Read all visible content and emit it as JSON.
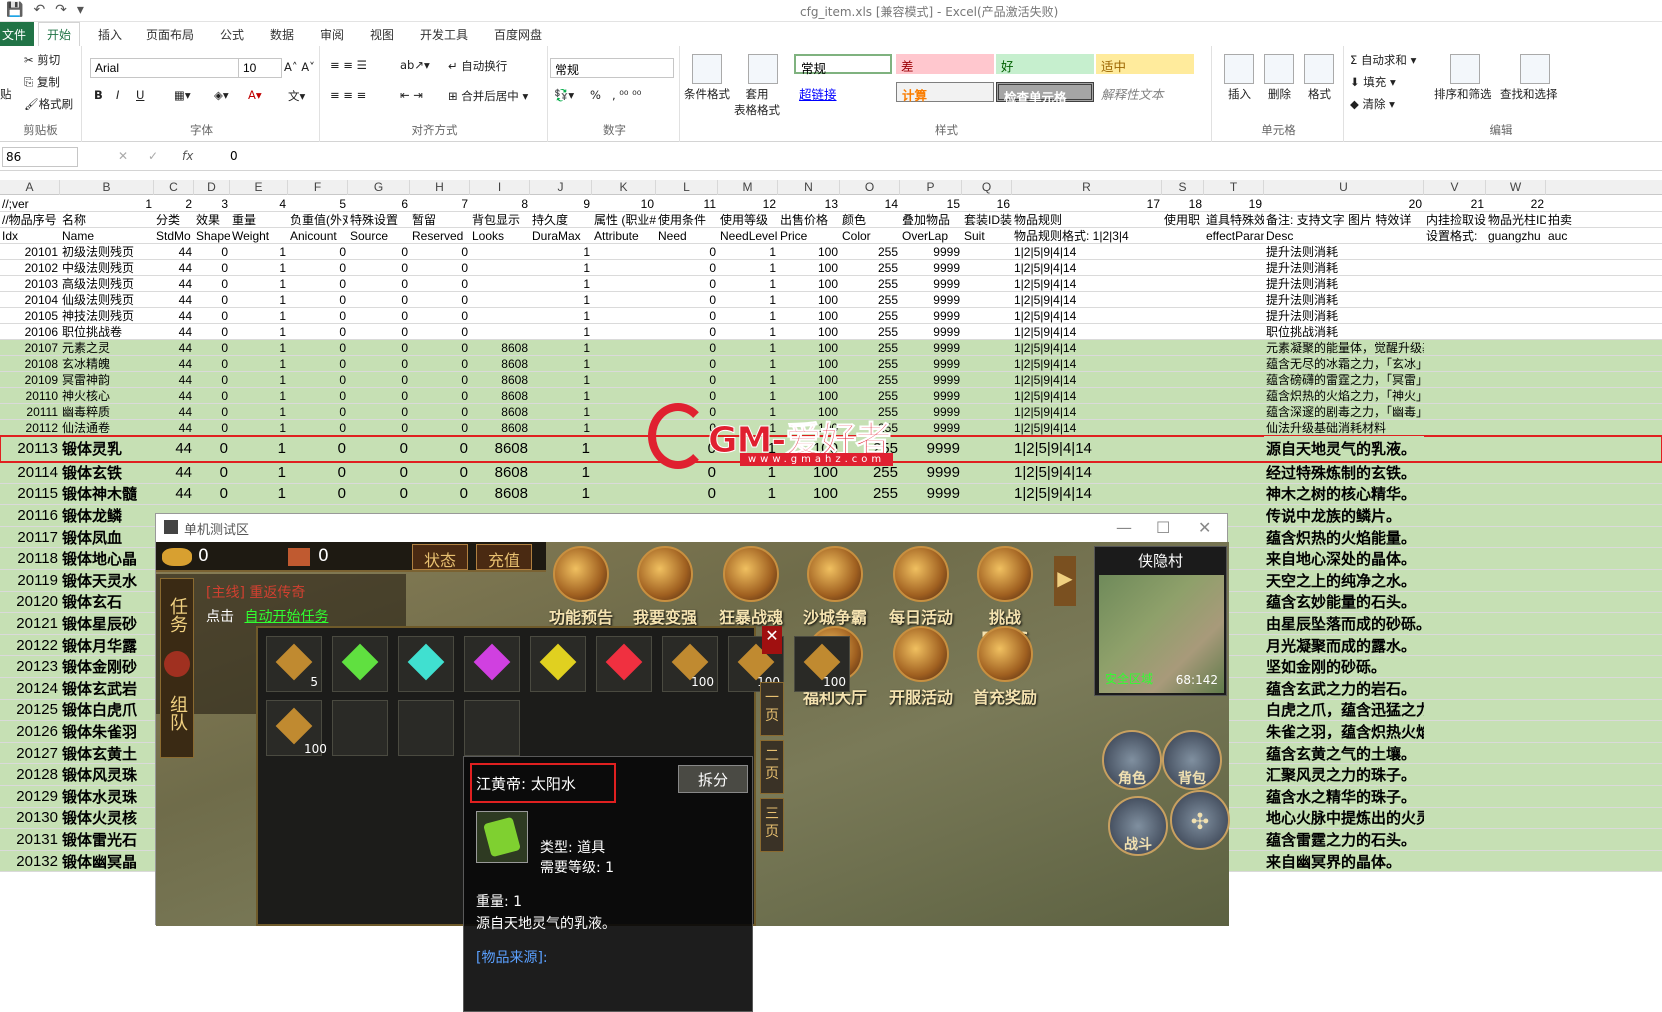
{
  "titlebar": {
    "title": "cfg_item.xls  [兼容模式] - Excel(产品激活失败)"
  },
  "tabs": [
    "文件",
    "开始",
    "插入",
    "页面布局",
    "公式",
    "数据",
    "审阅",
    "视图",
    "开发工具",
    "百度网盘"
  ],
  "ribbon": {
    "clipboard": {
      "cut": "剪切",
      "copy": "复制",
      "format_painter": "格式刷",
      "paste": "贴",
      "label": "剪贴板"
    },
    "font": {
      "name": "Arial",
      "size": "10",
      "label": "字体",
      "bold": "B",
      "italic": "I",
      "underline": "U"
    },
    "align": {
      "wrap": "自动换行",
      "merge": "合并后居中",
      "label": "对齐方式"
    },
    "number": {
      "format": "常规",
      "pct": "%",
      "label": "数字"
    },
    "styles": {
      "cond": "条件格式",
      "table": "套用\n表格格式",
      "normal": "常规",
      "bad": "差",
      "good": "好",
      "neutral": "适中",
      "hyperlink": "超链接",
      "calc": "计算",
      "check": "检查单元格",
      "explain": "解释性文本",
      "label": "样式"
    },
    "cells": {
      "insert": "插入",
      "delete": "删除",
      "format": "格式",
      "label": "单元格"
    },
    "editing": {
      "autosum": "自动求和",
      "fill": "填充",
      "clear": "清除",
      "sort": "排序和筛选",
      "find": "查找和选择",
      "label": "编辑"
    }
  },
  "formula_bar": {
    "name_box": "86",
    "fx": "fx",
    "value": "0"
  },
  "columns": [
    "A",
    "B",
    "C",
    "D",
    "E",
    "F",
    "G",
    "H",
    "I",
    "J",
    "K",
    "L",
    "M",
    "N",
    "O",
    "P",
    "Q",
    "R",
    "S",
    "T",
    "U",
    "V",
    "W"
  ],
  "header_rows": [
    [
      "//;ver",
      "1",
      "2",
      "3",
      "4",
      "5",
      "6",
      "7",
      "8",
      "9",
      "10",
      "11",
      "12",
      "13",
      "14",
      "15",
      "16",
      "17",
      "18",
      "19",
      "20",
      "21",
      "22"
    ],
    [
      "//物品序号",
      "名称",
      "分类",
      "效果",
      "重量",
      "负重值(外对",
      "特殊设置",
      "暂留",
      "背包显示",
      "持久度",
      "属性 (职业#",
      "使用条件",
      "使用等级",
      "出售价格",
      "颜色",
      "叠加物品",
      "套装ID装",
      "物品规则",
      "使用职",
      "道具特殊效",
      "备注: 支持文字 图片 特效详",
      "内挂捡取设",
      "物品光柱ID",
      "拍卖"
    ],
    [
      "Idx",
      "Name",
      "StdMo",
      "Shape",
      "Weight",
      "Anicount",
      "Source",
      "Reserved",
      "Looks",
      "DuraMax",
      "Attribute",
      "Need",
      "NeedLevel",
      "Price",
      "Color",
      "OverLap",
      "Suit",
      "物品规则格式: 1|2|3|4",
      "",
      "effectParam",
      "Desc",
      "设置格式:",
      "guangzhu",
      "auc"
    ]
  ],
  "rows": [
    {
      "idx": "20101",
      "name": "初级法则残页",
      "stdmode": "44",
      "shape": "0",
      "weight": "1",
      "anicount": "0",
      "source": "0",
      "reserved": "0",
      "looks": "",
      "dura": "1",
      "need": "0",
      "needlevel": "1",
      "price": "100",
      "color": "255",
      "overlap": "9999",
      "rule": "1|2|5|9|4|14",
      "desc": "提升法则消耗",
      "style": "normal"
    },
    {
      "idx": "20102",
      "name": "中级法则残页",
      "stdmode": "44",
      "shape": "0",
      "weight": "1",
      "anicount": "0",
      "source": "0",
      "reserved": "0",
      "looks": "",
      "dura": "1",
      "need": "0",
      "needlevel": "1",
      "price": "100",
      "color": "255",
      "overlap": "9999",
      "rule": "1|2|5|9|4|14",
      "desc": "提升法则消耗",
      "style": "normal"
    },
    {
      "idx": "20103",
      "name": "高级法则残页",
      "stdmode": "44",
      "shape": "0",
      "weight": "1",
      "anicount": "0",
      "source": "0",
      "reserved": "0",
      "looks": "",
      "dura": "1",
      "need": "0",
      "needlevel": "1",
      "price": "100",
      "color": "255",
      "overlap": "9999",
      "rule": "1|2|5|9|4|14",
      "desc": "提升法则消耗",
      "style": "normal"
    },
    {
      "idx": "20104",
      "name": "仙级法则残页",
      "stdmode": "44",
      "shape": "0",
      "weight": "1",
      "anicount": "0",
      "source": "0",
      "reserved": "0",
      "looks": "",
      "dura": "1",
      "need": "0",
      "needlevel": "1",
      "price": "100",
      "color": "255",
      "overlap": "9999",
      "rule": "1|2|5|9|4|14",
      "desc": "提升法则消耗",
      "style": "normal"
    },
    {
      "idx": "20105",
      "name": "神技法则残页",
      "stdmode": "44",
      "shape": "0",
      "weight": "1",
      "anicount": "0",
      "source": "0",
      "reserved": "0",
      "looks": "",
      "dura": "1",
      "need": "0",
      "needlevel": "1",
      "price": "100",
      "color": "255",
      "overlap": "9999",
      "rule": "1|2|5|9|4|14",
      "desc": "提升法则消耗",
      "style": "normal"
    },
    {
      "idx": "20106",
      "name": "职位挑战卷",
      "stdmode": "44",
      "shape": "0",
      "weight": "1",
      "anicount": "0",
      "source": "0",
      "reserved": "0",
      "looks": "",
      "dura": "1",
      "need": "0",
      "needlevel": "1",
      "price": "100",
      "color": "255",
      "overlap": "9999",
      "rule": "1|2|5|9|4|14",
      "desc": "职位挑战消耗",
      "style": "normal"
    },
    {
      "idx": "20107",
      "name": "元素之灵",
      "stdmode": "44",
      "shape": "0",
      "weight": "1",
      "anicount": "0",
      "source": "0",
      "reserved": "0",
      "looks": "8608",
      "dura": "1",
      "need": "0",
      "needlevel": "1",
      "price": "100",
      "color": "255",
      "overlap": "9999",
      "rule": "1|2|5|9|4|14",
      "desc": "元素凝聚的能量体，觉醒升级基础消耗材料",
      "style": "green"
    },
    {
      "idx": "20108",
      "name": "玄冰精魄",
      "stdmode": "44",
      "shape": "0",
      "weight": "1",
      "anicount": "0",
      "source": "0",
      "reserved": "0",
      "looks": "8608",
      "dura": "1",
      "need": "0",
      "needlevel": "1",
      "price": "100",
      "color": "255",
      "overlap": "9999",
      "rule": "1|2|5|9|4|14",
      "desc": "蕴含无尽的冰霜之力，「玄冰」升级消耗材料",
      "style": "green"
    },
    {
      "idx": "20109",
      "name": "冥雷神韵",
      "stdmode": "44",
      "shape": "0",
      "weight": "1",
      "anicount": "0",
      "source": "0",
      "reserved": "0",
      "looks": "8608",
      "dura": "1",
      "need": "0",
      "needlevel": "1",
      "price": "100",
      "color": "255",
      "overlap": "9999",
      "rule": "1|2|5|9|4|14",
      "desc": "蕴含磅礴的雷霆之力，「冥雷」升级消耗材料",
      "style": "green"
    },
    {
      "idx": "20110",
      "name": "神火核心",
      "stdmode": "44",
      "shape": "0",
      "weight": "1",
      "anicount": "0",
      "source": "0",
      "reserved": "0",
      "looks": "8608",
      "dura": "1",
      "need": "0",
      "needlevel": "1",
      "price": "100",
      "color": "255",
      "overlap": "9999",
      "rule": "1|2|5|9|4|14",
      "desc": "蕴含炽热的火焰之力，「神火」升级消耗材料",
      "style": "green"
    },
    {
      "idx": "20111",
      "name": "幽毒粹质",
      "stdmode": "44",
      "shape": "0",
      "weight": "1",
      "anicount": "0",
      "source": "0",
      "reserved": "0",
      "looks": "8608",
      "dura": "1",
      "need": "0",
      "needlevel": "1",
      "price": "100",
      "color": "255",
      "overlap": "9999",
      "rule": "1|2|5|9|4|14",
      "desc": "蕴含深邃的剧毒之力，「幽毒」升级消耗材料",
      "style": "green"
    },
    {
      "idx": "20112",
      "name": "仙法通卷",
      "stdmode": "44",
      "shape": "0",
      "weight": "1",
      "anicount": "0",
      "source": "0",
      "reserved": "0",
      "looks": "8608",
      "dura": "1",
      "need": "0",
      "needlevel": "1",
      "price": "100",
      "color": "255",
      "overlap": "9999",
      "rule": "1|2|5|9|4|14",
      "desc": "仙法升级基础消耗材料",
      "style": "green"
    },
    {
      "idx": "20113",
      "name": "锻体灵乳",
      "stdmode": "44",
      "shape": "0",
      "weight": "1",
      "anicount": "0",
      "source": "0",
      "reserved": "0",
      "looks": "8608",
      "dura": "1",
      "need": "0",
      "needlevel": "1",
      "price": "100",
      "color": "255",
      "overlap": "9999",
      "rule": "1|2|5|9|4|14",
      "desc": "源自天地灵气的乳液。",
      "style": "big sel green"
    },
    {
      "idx": "20114",
      "name": "锻体玄铁",
      "stdmode": "44",
      "shape": "0",
      "weight": "1",
      "anicount": "0",
      "source": "0",
      "reserved": "0",
      "looks": "8608",
      "dura": "1",
      "need": "0",
      "needlevel": "1",
      "price": "100",
      "color": "255",
      "overlap": "9999",
      "rule": "1|2|5|9|4|14",
      "desc": "经过特殊炼制的玄铁。",
      "style": "big green"
    },
    {
      "idx": "20115",
      "name": "锻体神木髓",
      "stdmode": "44",
      "shape": "0",
      "weight": "1",
      "anicount": "0",
      "source": "0",
      "reserved": "0",
      "looks": "8608",
      "dura": "1",
      "need": "0",
      "needlevel": "1",
      "price": "100",
      "color": "255",
      "overlap": "9999",
      "rule": "1|2|5|9|4|14",
      "desc": "神木之树的核心精华。",
      "style": "big green"
    },
    {
      "idx": "20116",
      "name": "锻体龙鳞",
      "desc": "传说中龙族的鳞片。",
      "style": "big green"
    },
    {
      "idx": "20117",
      "name": "锻体凤血",
      "desc": "蕴含炽热的火焰能量。",
      "style": "big green"
    },
    {
      "idx": "20118",
      "name": "锻体地心晶",
      "desc": "来自地心深处的晶体。",
      "style": "big green"
    },
    {
      "idx": "20119",
      "name": "锻体天灵水",
      "desc": "天空之上的纯净之水。",
      "style": "big green"
    },
    {
      "idx": "20120",
      "name": "锻体玄石",
      "desc": "蕴含玄妙能量的石头。",
      "style": "big green"
    },
    {
      "idx": "20121",
      "name": "锻体星辰砂",
      "desc": "由星辰坠落而成的砂砾。",
      "style": "big green"
    },
    {
      "idx": "20122",
      "name": "锻体月华露",
      "desc": "月光凝聚而成的露水。",
      "style": "big green"
    },
    {
      "idx": "20123",
      "name": "锻体金刚砂",
      "desc": "坚如金刚的砂砾。",
      "style": "big green"
    },
    {
      "idx": "20124",
      "name": "锻体玄武岩",
      "desc": "蕴含玄武之力的岩石。",
      "style": "big green"
    },
    {
      "idx": "20125",
      "name": "锻体白虎爪",
      "desc": "白虎之爪，蕴含迅猛之力。",
      "style": "big green"
    },
    {
      "idx": "20126",
      "name": "锻体朱雀羽",
      "desc": "朱雀之羽，蕴含炽热火焰。",
      "style": "big green"
    },
    {
      "idx": "20127",
      "name": "锻体玄黄土",
      "desc": "蕴含玄黄之气的土壤。",
      "style": "big green"
    },
    {
      "idx": "20128",
      "name": "锻体风灵珠",
      "desc": "汇聚风灵之力的珠子。",
      "style": "big green"
    },
    {
      "idx": "20129",
      "name": "锻体水灵珠",
      "desc": "蕴含水之精华的珠子。",
      "style": "big green"
    },
    {
      "idx": "20130",
      "name": "锻体火灵核",
      "desc": "地心火脉中提炼出的火灵核心。",
      "style": "big green"
    },
    {
      "idx": "20131",
      "name": "锻体雷光石",
      "desc": "蕴含雷霆之力的石头。",
      "style": "big green"
    },
    {
      "idx": "20132",
      "name": "锻体幽冥晶",
      "desc": "来自幽冥界的晶体。",
      "style": "big green"
    }
  ],
  "watermark": {
    "text": "GM-爱好者",
    "url": "www.gmahz.com"
  },
  "game": {
    "window_title": "单机测试区",
    "gold": "0",
    "ingot": "0",
    "btn_status": "状态",
    "btn_recharge": "充值",
    "skills_row1": [
      "功能预告",
      "我要变强",
      "狂暴战魂",
      "沙城争霸",
      "每日活动",
      "挑战BOSS"
    ],
    "skills_row2": [
      "福利大厅",
      "开服活动",
      "首充奖励"
    ],
    "map_name": "侠隐村",
    "zone": "安全区域",
    "coord": "68:142",
    "task_title": "[主线] 重返传奇",
    "task_click": "点击",
    "task_link": "自动开始任务",
    "side_tabs": [
      "任务",
      "组队"
    ],
    "pages": [
      "一页",
      "二页",
      "三页"
    ],
    "slot_counts": [
      "5",
      "",
      "",
      "",
      "",
      "",
      "100",
      "100",
      "100"
    ],
    "round_btns": [
      "角色",
      "背包",
      "战斗"
    ],
    "tooltip": {
      "name": "江黄帝: 太阳水",
      "split": "拆分",
      "type": "类型: 道具",
      "level": "需要等级: 1",
      "weight": "重量: 1",
      "desc": "源自天地灵气的乳液。",
      "source": "[物品来源]:"
    }
  },
  "colors": {
    "green_fill": "#c6e0b4",
    "excel_green": "#217346",
    "highlight_red": "#e02020"
  }
}
